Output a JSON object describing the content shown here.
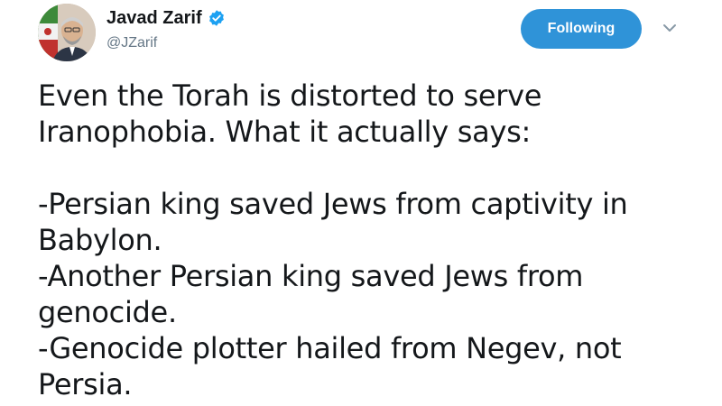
{
  "user": {
    "display_name": "Javad Zarif",
    "handle": "@JZarif",
    "verified_icon": "verified-badge-icon",
    "avatar": "avatar-photo"
  },
  "actions": {
    "follow_label": "Following",
    "menu_icon": "chevron-down-icon"
  },
  "colors": {
    "follow_button_bg": "#2f93d8",
    "verified": "#1da1f2",
    "text": "#14171a",
    "secondary_text": "#657786"
  },
  "tweet": {
    "lines": [
      "Even the Torah is distorted to serve",
      "Iranophobia. What it actually says:",
      "",
      "-Persian king saved Jews from captivity in",
      "Babylon.",
      "-Another Persian king saved Jews from",
      "genocide.",
      "-Genocide plotter hailed from Negev, not",
      "Persia."
    ]
  }
}
